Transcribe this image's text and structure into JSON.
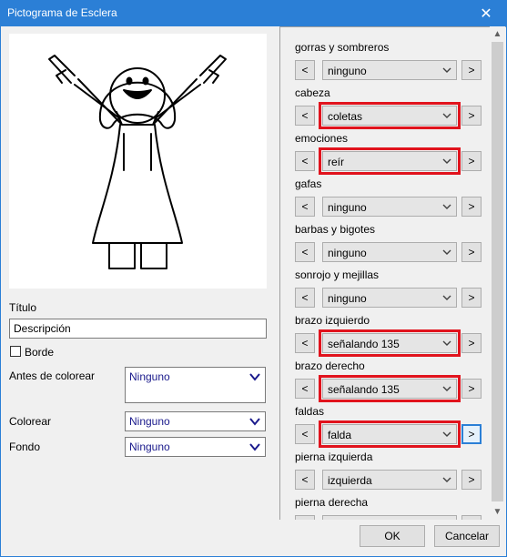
{
  "window": {
    "title": "Pictograma de Esclera",
    "close_glyph": "✕"
  },
  "left": {
    "title_label": "Título",
    "description_value": "Descripción",
    "border_label": "Borde",
    "before_color_label": "Antes de colorear",
    "before_color_value": "Ninguno",
    "color_label": "Colorear",
    "color_value": "Ninguno",
    "background_label": "Fondo",
    "background_value": "Ninguno"
  },
  "categories": [
    {
      "label": "gorras y sombreros",
      "value": "ninguno",
      "highlighted": false
    },
    {
      "label": "cabeza",
      "value": "coletas",
      "highlighted": true
    },
    {
      "label": "emociones",
      "value": "reír",
      "highlighted": true
    },
    {
      "label": "gafas",
      "value": "ninguno",
      "highlighted": false
    },
    {
      "label": "barbas y bigotes",
      "value": "ninguno",
      "highlighted": false
    },
    {
      "label": "sonrojo y mejillas",
      "value": "ninguno",
      "highlighted": false
    },
    {
      "label": "brazo izquierdo",
      "value": "señalando 135",
      "highlighted": true
    },
    {
      "label": "brazo derecho",
      "value": "señalando 135",
      "highlighted": true
    },
    {
      "label": "faldas",
      "value": "falda",
      "highlighted": true
    },
    {
      "label": "pierna izquierda",
      "value": "izquierda",
      "highlighted": false
    },
    {
      "label": "pierna derecha",
      "value": "",
      "highlighted": false
    }
  ],
  "nav": {
    "prev": "<",
    "next": ">"
  },
  "footer": {
    "ok": "OK",
    "cancel": "Cancelar"
  },
  "colors": {
    "titlebar": "#2b7fd6",
    "highlight": "#e1131d",
    "link_text": "#1a1a8c"
  }
}
